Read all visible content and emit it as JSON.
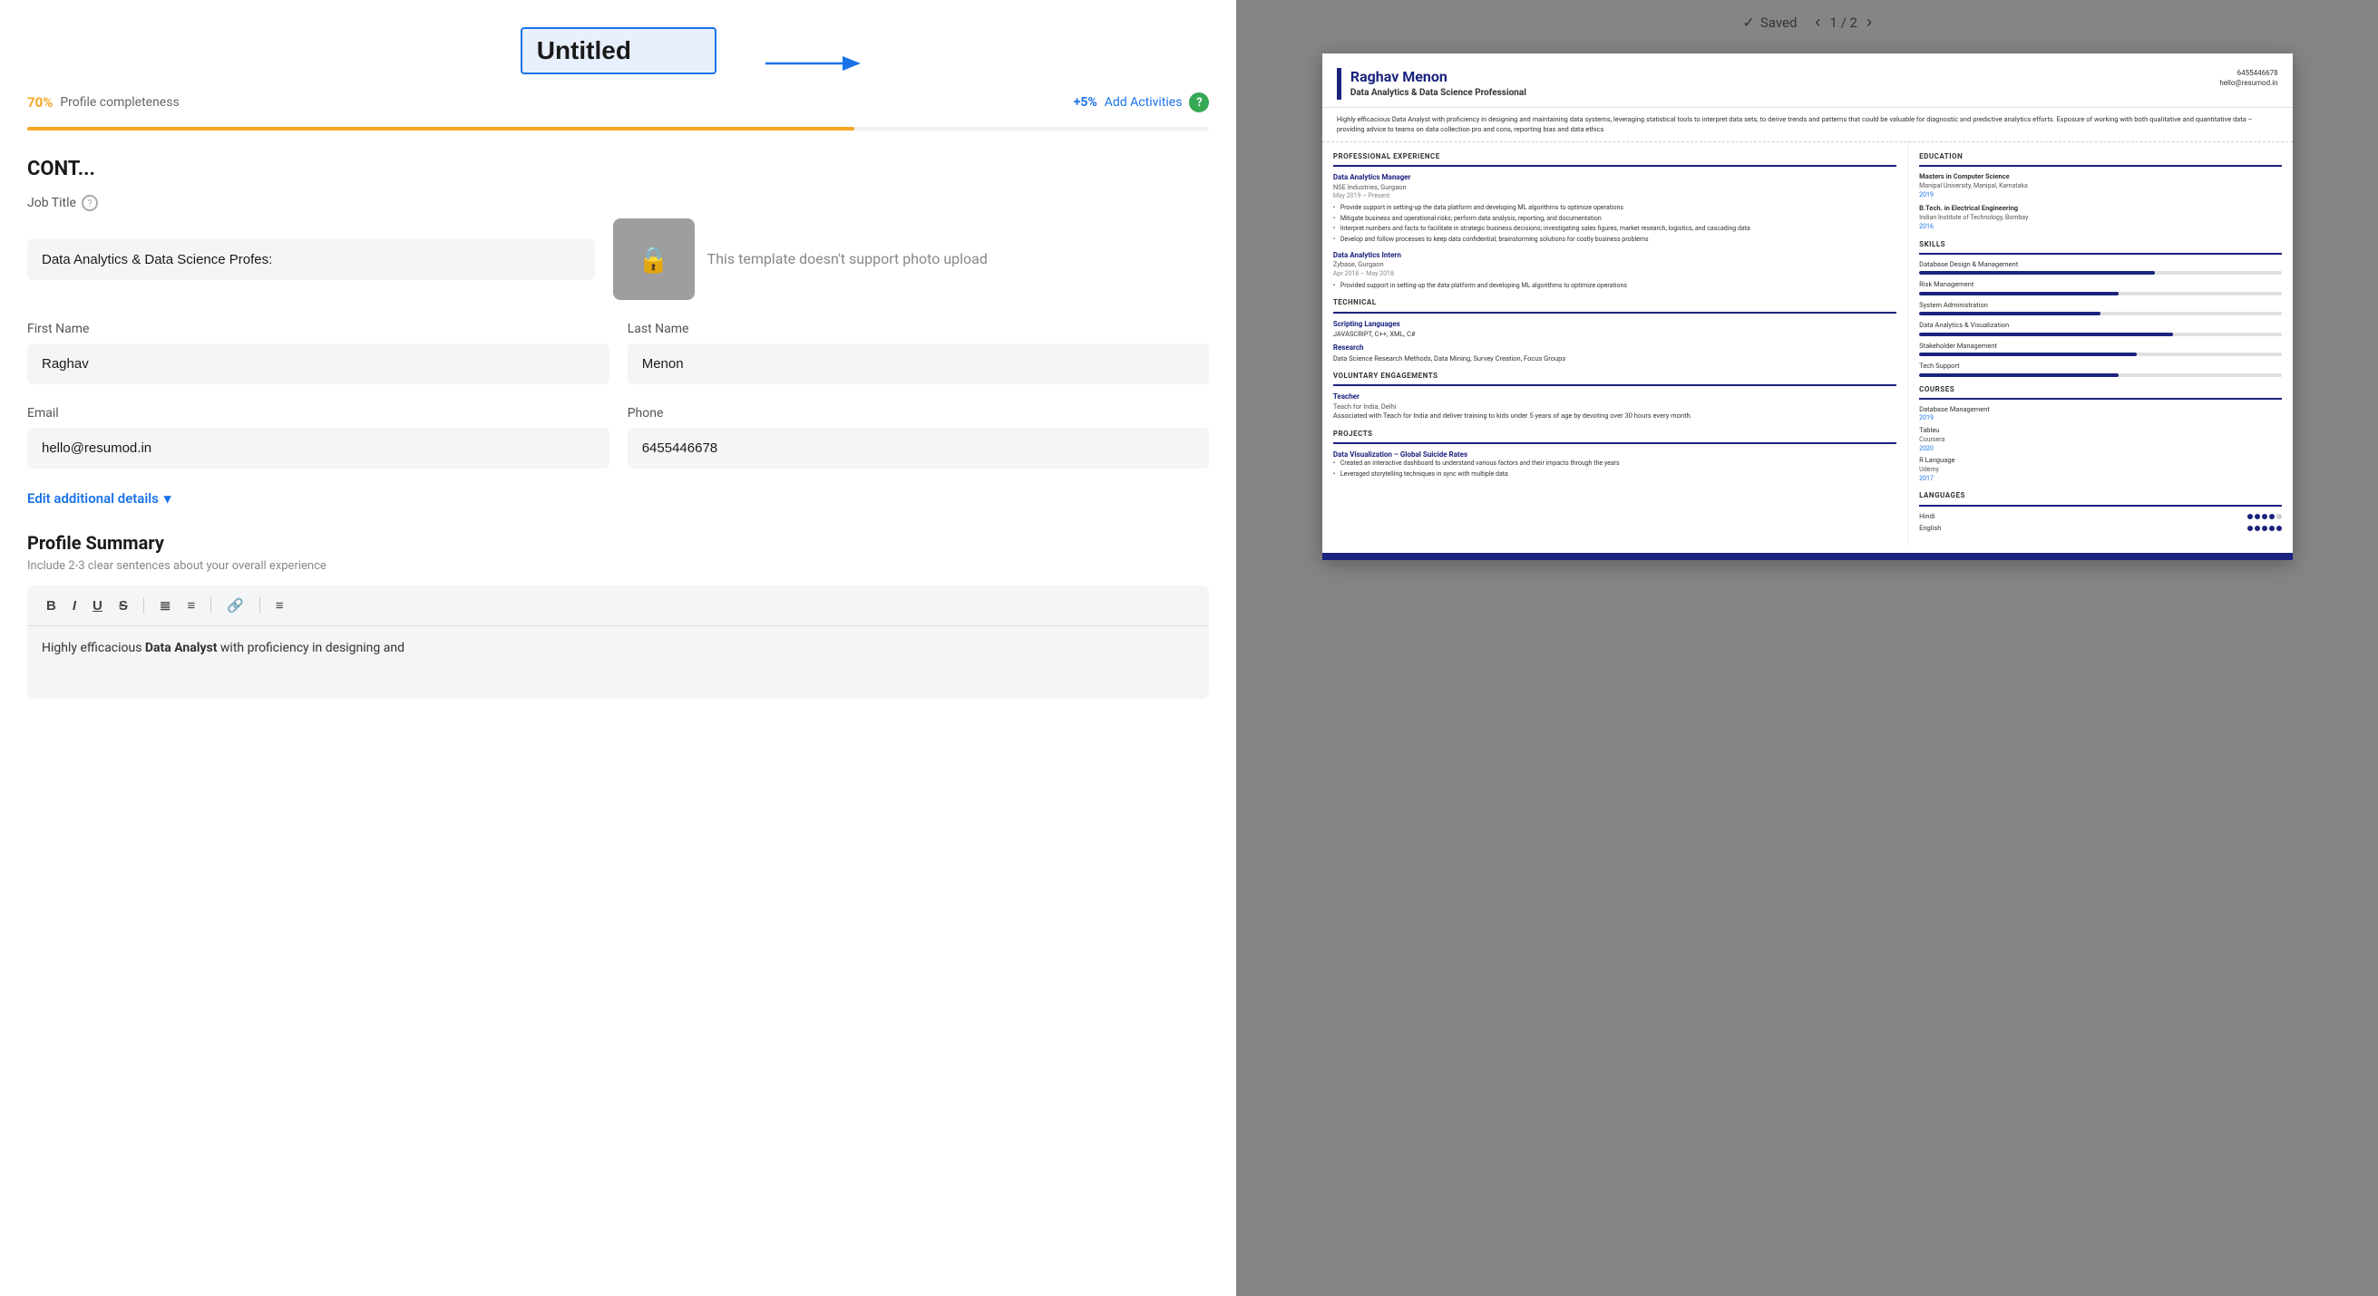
{
  "app": {
    "title": "Untitled",
    "saved_label": "Saved",
    "page_current": 1,
    "page_total": 2
  },
  "left": {
    "progress": {
      "percent": "70%",
      "label": "Profile completeness",
      "add_label": "+5%",
      "add_activities": "Add Activities",
      "fill_width": "70%"
    },
    "section_heading": "CONT...",
    "job_title": {
      "label": "Job Title",
      "value": "Data Analytics & Data Science Profes:",
      "placeholder": "Data Analytics & Data Science Profes:"
    },
    "photo_message": "This template doesn't support photo upload",
    "first_name": {
      "label": "First Name",
      "value": "Raghav"
    },
    "last_name": {
      "label": "Last Name",
      "value": "Menon"
    },
    "email": {
      "label": "Email",
      "value": "hello@resumod.in"
    },
    "phone": {
      "label": "Phone",
      "value": "6455446678"
    },
    "edit_additional": "Edit additional details",
    "profile_summary": {
      "title": "Profile Summary",
      "subtitle": "Include 2-3 clear sentences about your overall experience",
      "content": "Highly efficacious Data Analyst with proficiency in designing and"
    },
    "toolbar": {
      "bold": "B",
      "italic": "I",
      "underline": "U",
      "strikethrough": "S",
      "ordered_list": "≡",
      "unordered_list": "≡",
      "link": "🔗",
      "align": "≡"
    }
  },
  "resume": {
    "name": "Raghav Menon",
    "title": "Data Analytics & Data Science Professional",
    "phone": "6455446678",
    "email": "hello@resumod.in",
    "summary": "Highly efficacious Data Analyst with proficiency in designing and maintaining data systems, leveraging statistical tools to interpret data sets, to derive trends and patterns that could be valuable for diagnostic and predictive analytics efforts. Exposure of working with both qualitative and quantitative data – providing advice to teams on data collection pro and cons, reporting bias and data ethics",
    "sections": {
      "professional_experience": {
        "label": "PROFESSIONAL EXPERIENCE",
        "jobs": [
          {
            "title": "Data Analytics Manager",
            "company": "NSE Industries, Gurgaon",
            "date": "May 2019 – Present",
            "bullets": [
              "Provide support in setting-up the data platform and developing ML algorithms to optimize operations",
              "Mitigate business and operational risks; perform data analysis, reporting, and documentation",
              "Interpret numbers and facts to facilitate in strategic business decisions; investigating sales figures, market research, logistics, and cascading data",
              "Develop and follow processes to keep data confidential; brainstorming solutions for costly business problems"
            ]
          },
          {
            "title": "Data Analytics Intern",
            "company": "Zybase, Gurgaon",
            "date": "Apr 2018 – May 2018",
            "bullets": [
              "Provided support in setting-up the data platform and developing ML algorithms to optimize operations"
            ]
          }
        ]
      },
      "technical": {
        "label": "TECHNICAL",
        "items": [
          {
            "category": "Scripting Languages",
            "detail": "JAVASCRIPT, C++, XML, C#"
          },
          {
            "category": "Research",
            "detail": "Data Science Research Methods, Data Mining, Survey Creation, Focus Groups"
          }
        ]
      },
      "voluntary": {
        "label": "VOLUNTARY ENGAGEMENTS",
        "items": [
          {
            "role": "Teacher",
            "org": "Teach for India, Delhi",
            "desc": "Associated with Teach for India and deliver training to kids under 5 years of age by devoting over 30 hours every month."
          }
        ]
      },
      "projects": {
        "label": "PROJECTS",
        "items": [
          {
            "title": "Data Visualization – Global Suicide Rates",
            "bullets": [
              "Created an interactive dashboard to understand various factors and their impacts through the years",
              "Leveraged storytelling techniques in sync with multiple data"
            ]
          }
        ]
      }
    },
    "education": {
      "label": "EDUCATION",
      "items": [
        {
          "degree": "Masters in Computer Science",
          "school": "Manipal University, Manipal, Karnataka",
          "year": "2019"
        },
        {
          "degree": "B.Tech. in Electrical Engineering",
          "school": "Indian Institute of Technology, Bombay",
          "year": "2016"
        }
      ]
    },
    "skills": {
      "label": "SKILLS",
      "items": [
        {
          "name": "Database Design & Management",
          "fill": 65
        },
        {
          "name": "Risk Management",
          "fill": 55
        },
        {
          "name": "System Administration",
          "fill": 50
        },
        {
          "name": "Data Analytics & Visualization",
          "fill": 70
        },
        {
          "name": "Stakeholder Management",
          "fill": 60
        },
        {
          "name": "Tech Support",
          "fill": 55
        }
      ]
    },
    "courses": {
      "label": "COURSES",
      "items": [
        {
          "name": "Database Management",
          "provider": "",
          "year": "2019"
        },
        {
          "name": "Tableu",
          "provider": "Coursera",
          "year": "2020"
        },
        {
          "name": "R Language",
          "provider": "Udemy",
          "year": "2017"
        }
      ]
    },
    "languages": {
      "label": "LANGUAGES",
      "items": [
        {
          "name": "Hindi",
          "dots": [
            1,
            1,
            1,
            1,
            0
          ]
        },
        {
          "name": "English",
          "dots": [
            1,
            1,
            1,
            1,
            1
          ]
        }
      ]
    }
  }
}
